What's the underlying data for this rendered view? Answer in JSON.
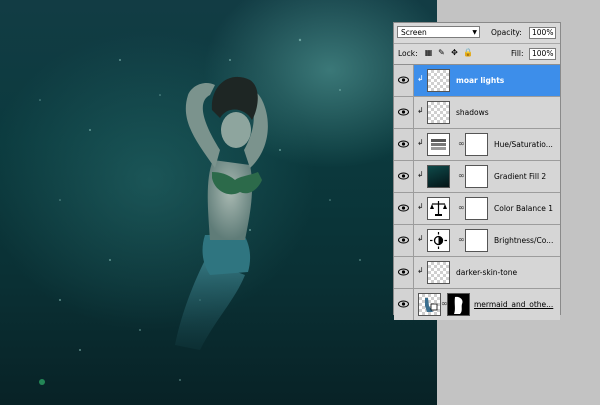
{
  "panel": {
    "blend_mode": "Screen",
    "opacity_label": "Opacity:",
    "opacity_value": "100%",
    "lock_label": "Lock:",
    "fill_label": "Fill:",
    "fill_value": "100%"
  },
  "layers": [
    {
      "name": "moar lights",
      "thumb": "transparent",
      "selected": true,
      "clipped": true
    },
    {
      "name": "shadows",
      "thumb": "transparent",
      "selected": false,
      "clipped": true
    },
    {
      "name": "Hue/Saturatio...",
      "thumb": "hue-saturation-icon",
      "mask": true,
      "selected": false,
      "clipped": true
    },
    {
      "name": "Gradient Fill 2",
      "thumb": "gradient",
      "mask": true,
      "selected": false,
      "clipped": true
    },
    {
      "name": "Color Balance 1",
      "thumb": "color-balance-icon",
      "mask": true,
      "selected": false,
      "clipped": true
    },
    {
      "name": "Brightness/Co...",
      "thumb": "brightness-contrast-icon",
      "mask": true,
      "selected": false,
      "clipped": true
    },
    {
      "name": "darker-skin-tone",
      "thumb": "transparent",
      "selected": false,
      "clipped": true
    },
    {
      "name": "mermaid_and_othe...",
      "thumb": "layer-photo",
      "mask": true,
      "selected": false,
      "clipped": false
    }
  ],
  "colors": {
    "selection": "#3d8eea",
    "panel_bg": "#d6d6d6",
    "water": "#0b3a3e"
  }
}
